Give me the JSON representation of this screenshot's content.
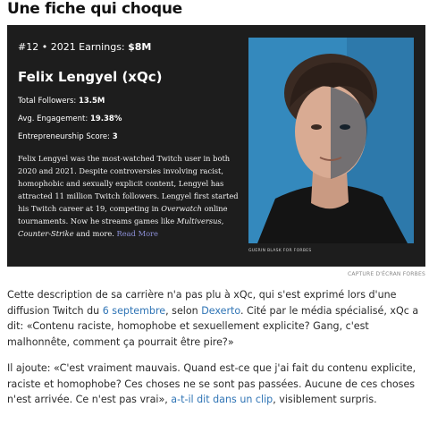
{
  "headline": "Une fiche qui choque",
  "card": {
    "rank": "#12 • 2021 Earnings: ",
    "earnings": "$8M",
    "name": "Felix Lengyel (xQc)",
    "followers_label": "Total Followers: ",
    "followers_value": "13.5M",
    "engagement_label": "Avg. Engagement: ",
    "engagement_value": "19.38%",
    "score_label": "Entrepreneurship Score: ",
    "score_value": "3",
    "bio_1": "Felix Lengyel was the most-watched Twitch user in both 2020 and 2021. Despite controversies involving racist, homophobic and sexually explicit content, Lengyel has attracted 11 million Twitch followers. Lengyel first started his Twitch career at 19, competing in ",
    "bio_overwatch": "Overwatch",
    "bio_2": " online tournaments. Now he streams games like ",
    "bio_multiversus": "Multiversus",
    "bio_3": ", ",
    "bio_cs": "Counter-Strike",
    "bio_4": " and more. ",
    "read_more": "Read More",
    "photo_credit": "GUERIN BLASK FOR FORBES"
  },
  "caption": "CAPTURE D'ÉCRAN FORBES",
  "paragraph1": {
    "t1": "Cette description de sa carrière n'a pas plu à xQc, qui s'est exprimé lors d'une diffusion Twitch du ",
    "link_date": "6 septembre",
    "t2": ", selon ",
    "link_source": "Dexerto",
    "t3": ". Cité par le média spécialisé, xQc a dit: «Contenu raciste, homophobe et sexuellement explicite? Gang, c'est malhonnête, comment ça pourrait être pire?»"
  },
  "paragraph2": {
    "t1": "Il ajoute: «C'est vraiment mauvais. Quand est-ce que j'ai fait du contenu explicite, raciste et homophobe? Ces choses ne se sont pas passées. Aucune de ces choses n'est arrivée. Ce n'est pas vrai», ",
    "link_clip": "a-t-il dit dans un clip",
    "t2": ", visiblement surpris."
  }
}
